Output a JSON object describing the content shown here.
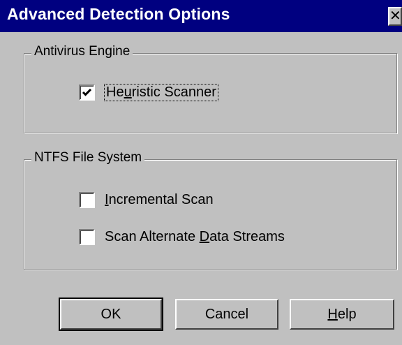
{
  "window": {
    "title": "Advanced Detection Options",
    "close_glyph": "✕"
  },
  "antivirus_group": {
    "label": "Antivirus Engine",
    "heuristic": {
      "checked": true,
      "label_pre": "He",
      "label_mnemonic": "u",
      "label_post": "ristic Scanner"
    }
  },
  "ntfs_group": {
    "label": "NTFS File System",
    "incremental": {
      "checked": false,
      "label_pre": "",
      "label_mnemonic": "I",
      "label_post": "ncremental Scan"
    },
    "alternate_streams": {
      "checked": false,
      "label_pre": "Scan Alternate ",
      "label_mnemonic": "D",
      "label_post": "ata Streams"
    }
  },
  "buttons": {
    "ok": "OK",
    "cancel": "Cancel",
    "help_mnemonic": "H",
    "help_rest": "elp"
  },
  "colors": {
    "face": "#c0c0c0",
    "titlebar": "#000080"
  }
}
